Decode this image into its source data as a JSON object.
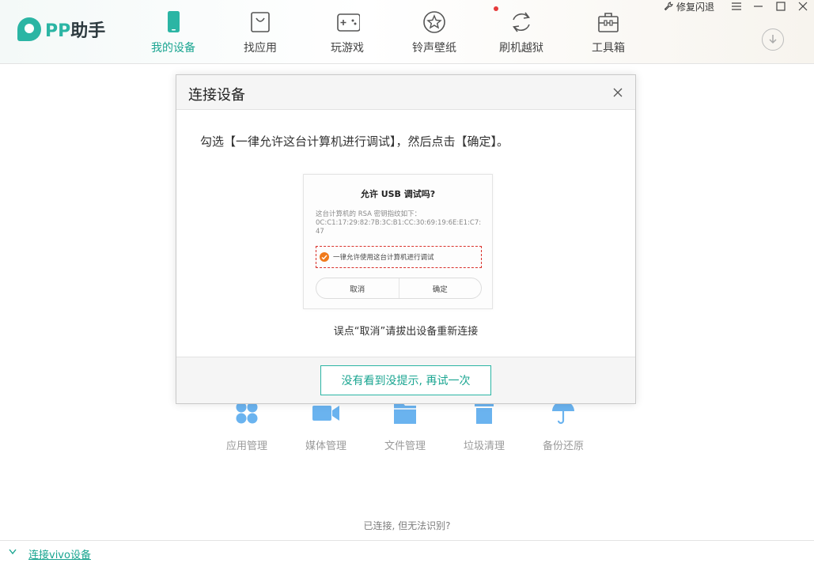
{
  "app": {
    "logo_pp": "PP",
    "logo_name": "助手"
  },
  "colors": {
    "accent": "#2bb5a4",
    "active_text": "#1aa591",
    "highlight_red": "#d9312b",
    "check_orange": "#f07a1c",
    "tool_icon_blue": "#6ab3ef"
  },
  "nav": {
    "items": [
      {
        "label": "我的设备",
        "icon": "phone-icon",
        "active": true
      },
      {
        "label": "找应用",
        "icon": "shopping-bag-icon"
      },
      {
        "label": "玩游戏",
        "icon": "gamepad-icon"
      },
      {
        "label": "铃声壁纸",
        "icon": "star-icon"
      },
      {
        "label": "刷机越狱",
        "icon": "refresh-icon"
      },
      {
        "label": "工具箱",
        "icon": "toolbox-icon",
        "badge": true
      }
    ]
  },
  "window": {
    "repair_label": "修复闪退",
    "menu_icon": "menu-icon",
    "minimize_icon": "minimize-icon",
    "maximize_icon": "maximize-icon",
    "close_icon": "close-icon",
    "download_icon": "download-icon"
  },
  "dialog": {
    "title": "连接设备",
    "instruction": "勾选【一律允许这台计算机进行调试】，然后点击【确定】。",
    "phone_prompt": {
      "title": "允许 USB 调试吗?",
      "body": "这台计算机的 RSA 密钥指纹如下：",
      "fingerprint": "0C:C1:17:29:82:7B:3C:B1:CC:30:69:19:6E:E1:C7:47",
      "checkbox_label": "一律允许使用这台计算机进行调试",
      "cancel": "取消",
      "confirm": "确定"
    },
    "note": "误点“取消”请拔出设备重新连接",
    "retry_button": "没有看到没提示, 再试一次"
  },
  "tools": [
    {
      "label": "应用管理",
      "icon": "apps-icon"
    },
    {
      "label": "媒体管理",
      "icon": "video-camera-icon"
    },
    {
      "label": "文件管理",
      "icon": "folder-icon"
    },
    {
      "label": "垃圾清理",
      "icon": "trash-icon"
    },
    {
      "label": "备份还原",
      "icon": "umbrella-icon"
    }
  ],
  "status": {
    "unrecognized": "已连接, 但无法识别?"
  },
  "footer": {
    "link": "连接vivo设备"
  }
}
